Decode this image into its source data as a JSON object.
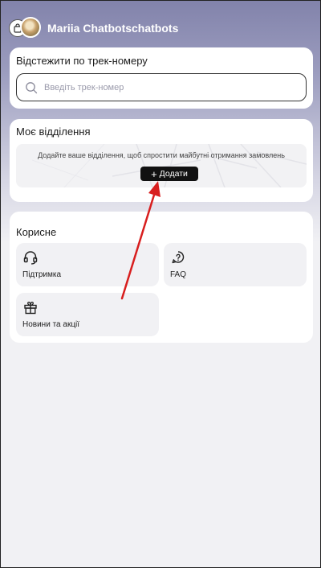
{
  "header": {
    "user_name": "Mariia Chatbotschatbots"
  },
  "tracking": {
    "title": "Відстежити по трек-номеру",
    "placeholder": "Введіть трек-номер",
    "value": ""
  },
  "branch": {
    "title": "Моє відділення",
    "hint": "Додайте ваше відділення, щоб спростити майбутні отримання замовлень",
    "add_label": "Додати"
  },
  "useful": {
    "title": "Корисне",
    "tiles": [
      {
        "label": "Підтримка",
        "icon": "headset-icon"
      },
      {
        "label": "FAQ",
        "icon": "help-chat-icon"
      },
      {
        "label": "Новини та акції",
        "icon": "gift-icon"
      }
    ]
  },
  "colors": {
    "header_gradient_top": "#8283ab",
    "page_background": "#f1f1f4",
    "card_background": "#ffffff",
    "button_background": "#111111",
    "annotation_arrow": "#d81e1e"
  }
}
